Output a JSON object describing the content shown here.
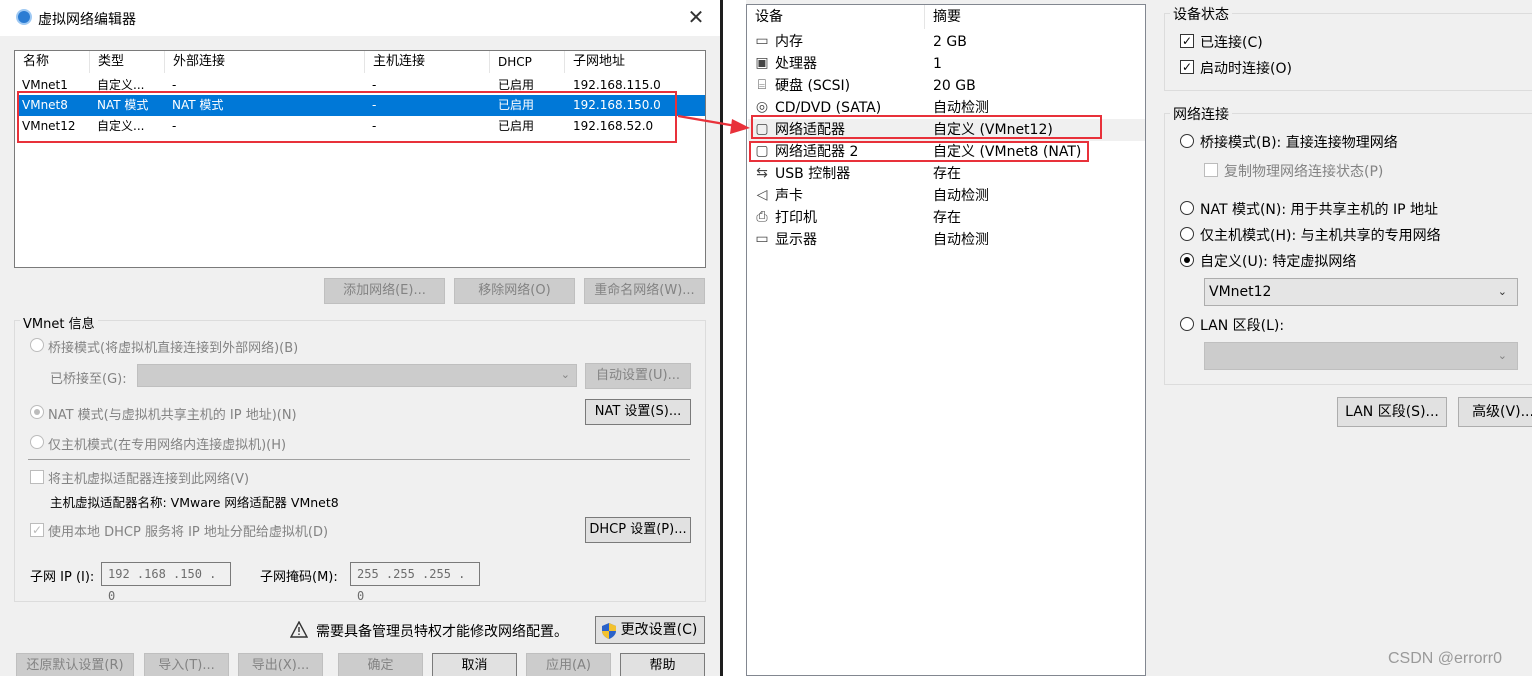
{
  "editor": {
    "title": "虚拟网络编辑器",
    "close": "✕",
    "columns": [
      "名称",
      "类型",
      "外部连接",
      "主机连接",
      "DHCP",
      "子网地址"
    ],
    "rows": [
      {
        "name": "VMnet1",
        "type": "自定义...",
        "external": "-",
        "host": "-",
        "dhcp": "已启用",
        "subnet": "192.168.115.0",
        "selected": false
      },
      {
        "name": "VMnet8",
        "type": "NAT 模式",
        "external": "NAT 模式",
        "host": "-",
        "dhcp": "已启用",
        "subnet": "192.168.150.0",
        "selected": true
      },
      {
        "name": "VMnet12",
        "type": "自定义...",
        "external": "-",
        "host": "-",
        "dhcp": "已启用",
        "subnet": "192.168.52.0",
        "selected": false
      }
    ],
    "add_network": "添加网络(E)...",
    "remove_network": "移除网络(O)",
    "rename_network": "重命名网络(W)...",
    "info_label": "VMnet 信息",
    "bridged_mode": "桥接模式(将虚拟机直接连接到外部网络)(B)",
    "bridged_to": "已桥接至(G):",
    "auto_settings": "自动设置(U)...",
    "nat_mode": "NAT 模式(与虚拟机共享主机的 IP 地址)(N)",
    "nat_settings": "NAT 设置(S)...",
    "host_only": "仅主机模式(在专用网络内连接虚拟机)(H)",
    "connect_host_adapter": "将主机虚拟适配器连接到此网络(V)",
    "adapter_name": "主机虚拟适配器名称: VMware 网络适配器 VMnet8",
    "use_dhcp": "使用本地 DHCP 服务将 IP 地址分配给虚拟机(D)",
    "dhcp_settings": "DHCP 设置(P)...",
    "subnet_ip_label": "子网 IP (I):",
    "subnet_ip": "192 .168 .150 .  0",
    "subnet_mask_label": "子网掩码(M):",
    "subnet_mask": "255 .255 .255 .  0",
    "admin_notice": "需要具备管理员特权才能修改网络配置。",
    "change_settings": "更改设置(C)",
    "restore_defaults": "还原默认设置(R)",
    "import": "导入(T)...",
    "export": "导出(X)...",
    "ok": "确定",
    "cancel": "取消",
    "apply": "应用(A)",
    "help": "帮助"
  },
  "vm_settings": {
    "col_device": "设备",
    "col_summary": "摘要",
    "devices": [
      {
        "icon": "memory-icon",
        "glyph": "▭",
        "name": "内存",
        "summary": "2 GB"
      },
      {
        "icon": "processor-icon",
        "glyph": "▣",
        "name": "处理器",
        "summary": "1"
      },
      {
        "icon": "harddisk-icon",
        "glyph": "⌸",
        "name": "硬盘 (SCSI)",
        "summary": "20 GB"
      },
      {
        "icon": "cdrom-icon",
        "glyph": "◎",
        "name": "CD/DVD (SATA)",
        "summary": "自动检测"
      },
      {
        "icon": "network-adapter-icon",
        "glyph": "▢",
        "name": "网络适配器",
        "summary": "自定义 (VMnet12)"
      },
      {
        "icon": "network-adapter-icon",
        "glyph": "▢",
        "name": "网络适配器 2",
        "summary": "自定义 (VMnet8 (NAT)"
      },
      {
        "icon": "usb-icon",
        "glyph": "⇆",
        "name": "USB 控制器",
        "summary": "存在"
      },
      {
        "icon": "sound-icon",
        "glyph": "◁",
        "name": "声卡",
        "summary": "自动检测"
      },
      {
        "icon": "printer-icon",
        "glyph": "⎙",
        "name": "打印机",
        "summary": "存在"
      },
      {
        "icon": "display-icon",
        "glyph": "▭",
        "name": "显示器",
        "summary": "自动检测"
      }
    ],
    "device_status": "设备状态",
    "connected": "已连接(C)",
    "connect_at_power_on": "启动时连接(O)",
    "network_connection": "网络连接",
    "bridged": "桥接模式(B): 直接连接物理网络",
    "replicate_state": "复制物理网络连接状态(P)",
    "nat": "NAT 模式(N): 用于共享主机的 IP 地址",
    "host_only": "仅主机模式(H): 与主机共享的专用网络",
    "custom": "自定义(U): 特定虚拟网络",
    "custom_network": "VMnet12",
    "lan_segment": "LAN 区段(L):",
    "lan_segments_button": "LAN 区段(S)...",
    "advanced_button": "高级(V)..."
  },
  "watermark": "CSDN @errorr0",
  "colors": {
    "selection": "#0078d7",
    "highlight": "#e8313a"
  }
}
